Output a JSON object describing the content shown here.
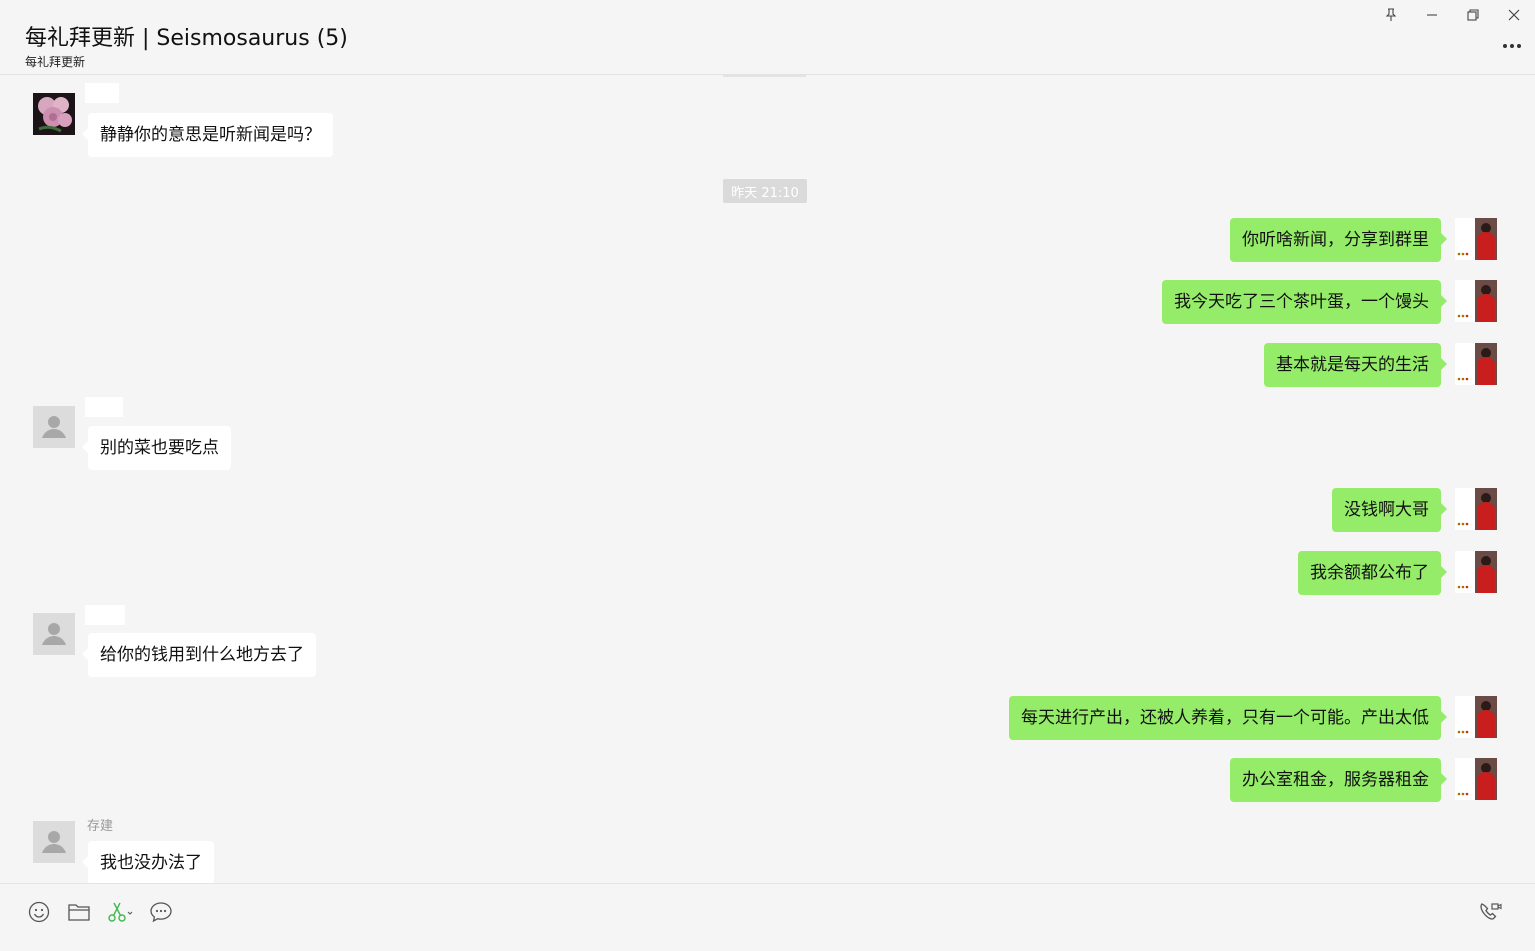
{
  "header": {
    "title": "每礼拜更新 | Seismosaurus (5)",
    "subtitle": "每礼拜更新"
  },
  "window_controls": [
    "pin-icon",
    "minimize-icon",
    "restore-icon",
    "close-icon"
  ],
  "messages": {
    "m1": "静静你的意思是听新闻是吗？",
    "time1": "昨天 21:10",
    "m2": "你听啥新闻，分享到群里",
    "m3": "我今天吃了三个茶叶蛋，一个馒头",
    "m4": "基本就是每天的生活",
    "m5": "别的菜也要吃点",
    "m6": "没钱啊大哥",
    "m7": "我余额都公布了",
    "m8": "给你的钱用到什么地方去了",
    "m9": "每天进行产出，还被人养着，只有一个可能。产出太低",
    "m10": "办公室租金，服务器租金",
    "m11_sender": "存建",
    "m11": "我也没办法了"
  },
  "toolbar_icons": [
    "emoji-icon",
    "folder-icon",
    "scissors-icon",
    "chat-history-icon",
    "video-call-icon"
  ],
  "colors": {
    "background": "#f5f5f5",
    "my_bubble": "#95ec69",
    "their_bubble": "#ffffff",
    "time_badge": "#dadada"
  }
}
